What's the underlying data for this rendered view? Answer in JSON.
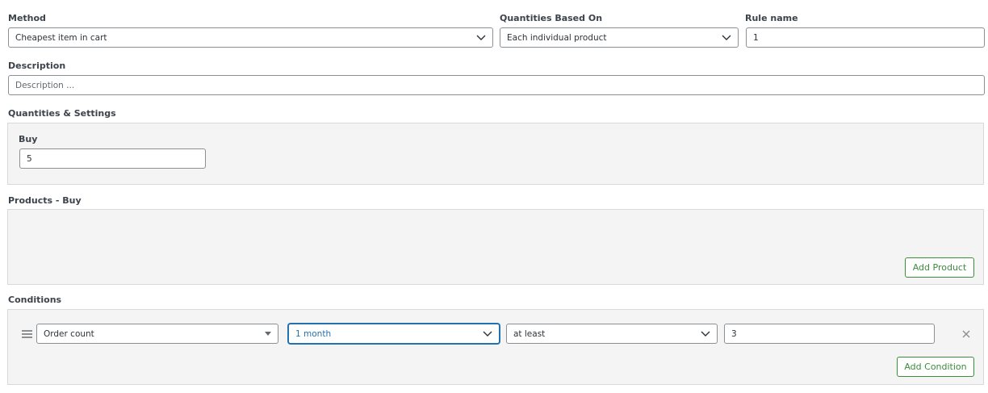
{
  "method": {
    "label": "Method",
    "value": "Cheapest item in cart"
  },
  "quantities_based_on": {
    "label": "Quantities Based On",
    "value": "Each individual product"
  },
  "rule_name": {
    "label": "Rule name",
    "value": "1"
  },
  "description": {
    "label": "Description",
    "placeholder": "Description ..."
  },
  "quantities_settings": {
    "label": "Quantities & Settings",
    "buy_label": "Buy",
    "buy_value": "5"
  },
  "products_buy": {
    "label": "Products - Buy",
    "add_button": "Add Product"
  },
  "conditions": {
    "label": "Conditions",
    "type_value": "Order count",
    "period_value": "1 month",
    "operator_value": "at least",
    "amount_value": "3",
    "add_button": "Add Condition"
  },
  "colors": {
    "accent_green": "#3c8c3c",
    "focus_blue": "#2271b1"
  }
}
